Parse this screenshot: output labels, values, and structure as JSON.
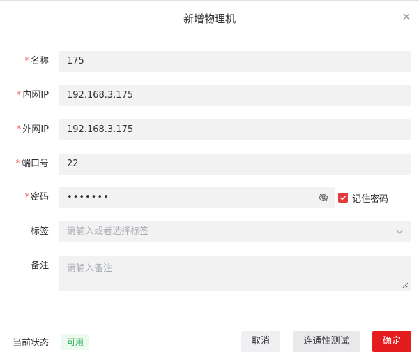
{
  "dialog": {
    "title": "新增物理机",
    "close_icon": "close-icon"
  },
  "form": {
    "name": {
      "label": "名称",
      "required_mark": "*",
      "value": "175"
    },
    "internal_ip": {
      "label": "内网IP",
      "required_mark": "*",
      "value": "192.168.3.175"
    },
    "external_ip": {
      "label": "外网IP",
      "required_mark": "*",
      "value": "192.168.3.175"
    },
    "port": {
      "label": "端口号",
      "required_mark": "*",
      "value": "22"
    },
    "password": {
      "label": "密码",
      "required_mark": "*",
      "value": "•••••••",
      "toggle_icon": "eye-slash-icon",
      "remember_label": "记住密码",
      "remember_checked": true
    },
    "tags": {
      "label": "标签",
      "placeholder": "请输入或者选择标签",
      "dropdown_icon": "chevron-down-icon"
    },
    "remark": {
      "label": "备注",
      "placeholder": "请输入备注"
    }
  },
  "footer": {
    "status_label": "当前状态",
    "status_value": "可用",
    "cancel_label": "取消",
    "test_label": "连通性测试",
    "confirm_label": "确定"
  },
  "colors": {
    "required": "#f56c6c",
    "primary": "#e51c1c",
    "status_available": "#2fb45a",
    "field_bg": "#f2f2f3"
  }
}
